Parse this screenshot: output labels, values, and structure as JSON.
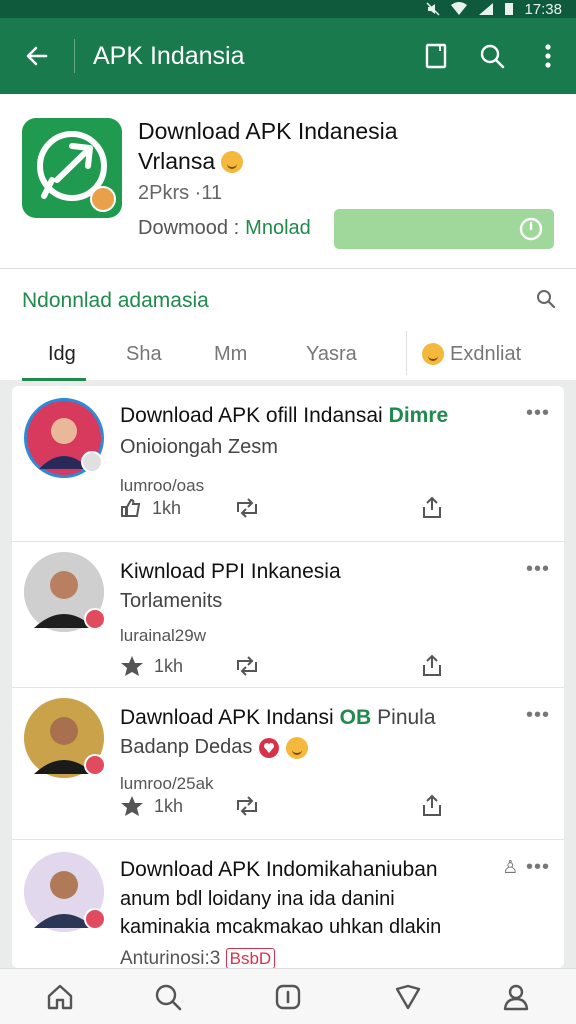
{
  "status": {
    "time": "17:38"
  },
  "appbar": {
    "title": "APK Indansia"
  },
  "app": {
    "title": "Download APK Indanesia",
    "subtitle": "Vrlansa",
    "meta": "2Pkrs ·11",
    "download_label": "Dowmood :",
    "download_status": "Mnolad"
  },
  "section": {
    "heading": "Ndonnlad adamasia",
    "tabs": [
      "Idg",
      "Sha",
      "Mm",
      "Yasra",
      "Exdnliat"
    ],
    "active_tab": 0
  },
  "posts": [
    {
      "title": "Download APK ofill Indansai",
      "title_badge": "Dimre",
      "line1": "Onioiongah Zesm",
      "small": "lumroo/oas",
      "count": "1kh"
    },
    {
      "title": "Kiwnload  PPI Inkanesia",
      "line1": "Torlamenits",
      "small": "lurainal29w",
      "count": "1kh"
    },
    {
      "title": "Dawnload APK Indansi",
      "title_badge": "OB",
      "title_extra": "Pinula",
      "line1": "Badanp Dedas",
      "small": "lumroo/25ak",
      "count": "1kh"
    },
    {
      "title": "Download APK Indomikahaniuban",
      "line1": "anum bdl loidany ina ida danini",
      "line2": "kaminakia mcakmakao uhkan dlakin",
      "small": "Anturinosi:3",
      "small_badge": "BsbD"
    }
  ],
  "colors": {
    "primary": "#187a4d",
    "status_bar": "#0f5a3c",
    "accent_green": "#1f8a4c",
    "download_bar": "#9fd89a",
    "badge_red": "#d6334b"
  },
  "icons": {
    "appbar": [
      "back-arrow-icon",
      "bookmark-icon",
      "search-icon",
      "more-vert-icon"
    ],
    "bottom_nav": [
      "home-icon",
      "search-icon",
      "info-icon",
      "shield-icon",
      "profile-icon"
    ]
  }
}
